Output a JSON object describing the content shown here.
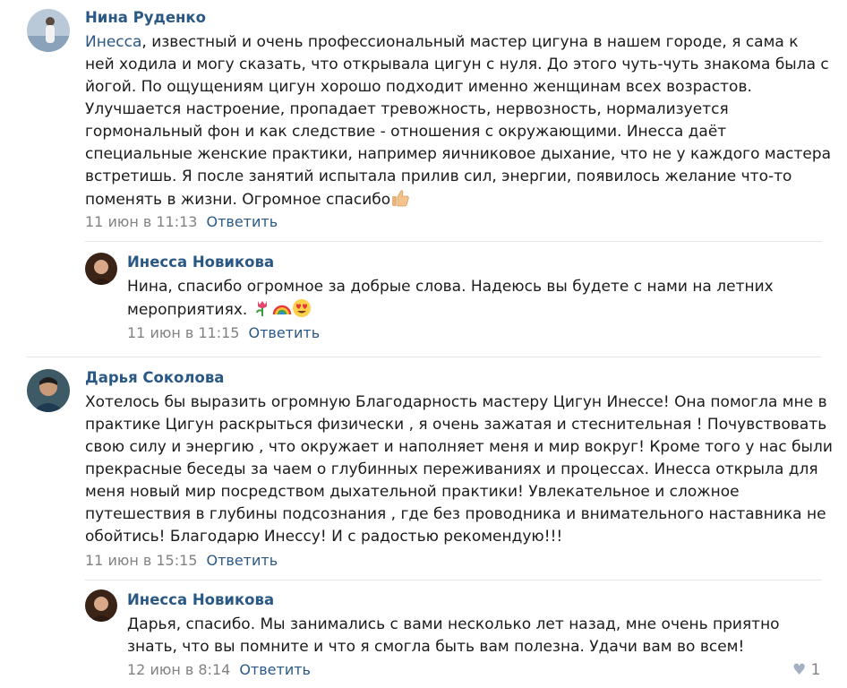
{
  "comments": [
    {
      "author": "Нина Руденко",
      "mention": "Инесса",
      "lines": [
        ", известный и очень профессиональный мастер цигуна в нашем городе, я сама к",
        "ней ходила и могу сказать, что открывала цигун с нуля. До этого чуть-чуть знакома была с",
        "йогой. По ощущениям цигун хорошо подходит именно женщинам всех возрастов.",
        "Улучшается настроение, пропадает тревожность, нервозность, нормализуется",
        "гормональный фон и как следствие - отношения с окружающими. Инесса даёт",
        "специальные женские практики, например яичниковое дыхание, что не у каждого мастера",
        "встретишь. Я после занятий испытала прилив сил, энергии, появилось желание что-то",
        "поменять в жизни. Огромное спасибо"
      ],
      "date": "11 июн в 11:13",
      "reply_label": "Ответить",
      "emoji": "thumbs-up-icon"
    },
    {
      "author": "Инесса Новикова",
      "lines": [
        "Нина, спасибо огромное за добрые слова. Надеюсь вы будете с нами на летних",
        "мероприятиях."
      ],
      "date": "11 июн в 11:15",
      "reply_label": "Ответить",
      "emojis": [
        "tulip-icon",
        "rainbow-icon",
        "heart-eyes-icon"
      ]
    },
    {
      "author": "Дарья Соколова",
      "lines": [
        "Хотелось бы выразить огромную Благодарность мастеру Цигун Инессе! Она помогла мне в",
        "практике Цигун раскрыться физически , я очень зажатая и стеснительная ! Почувствовать",
        "свою силу и энергию , что окружает и наполняет меня и мир вокруг! Кроме того у нас были",
        "прекрасные беседы за чаем о глубинных переживаниях и процессах. Инесса открыла для",
        "меня новый мир посредством дыхательной практики! Увлекательное и сложное",
        "путешествия в глубины подсознания , где без проводника и внимательного наставника не",
        "обойтись! Благодарю Инессу! И с радостью рекомендую!!!"
      ],
      "date": "11 июн в 15:15",
      "reply_label": "Ответить"
    },
    {
      "author": "Инесса Новикова",
      "lines": [
        "Дарья, спасибо. Мы занимались с вами несколько лет назад, мне очень приятно",
        "знать, что вы помните и что я смогла быть вам полезна. Удачи вам во всем!"
      ],
      "date": "12 июн в 8:14",
      "reply_label": "Ответить",
      "likes": "1"
    }
  ]
}
